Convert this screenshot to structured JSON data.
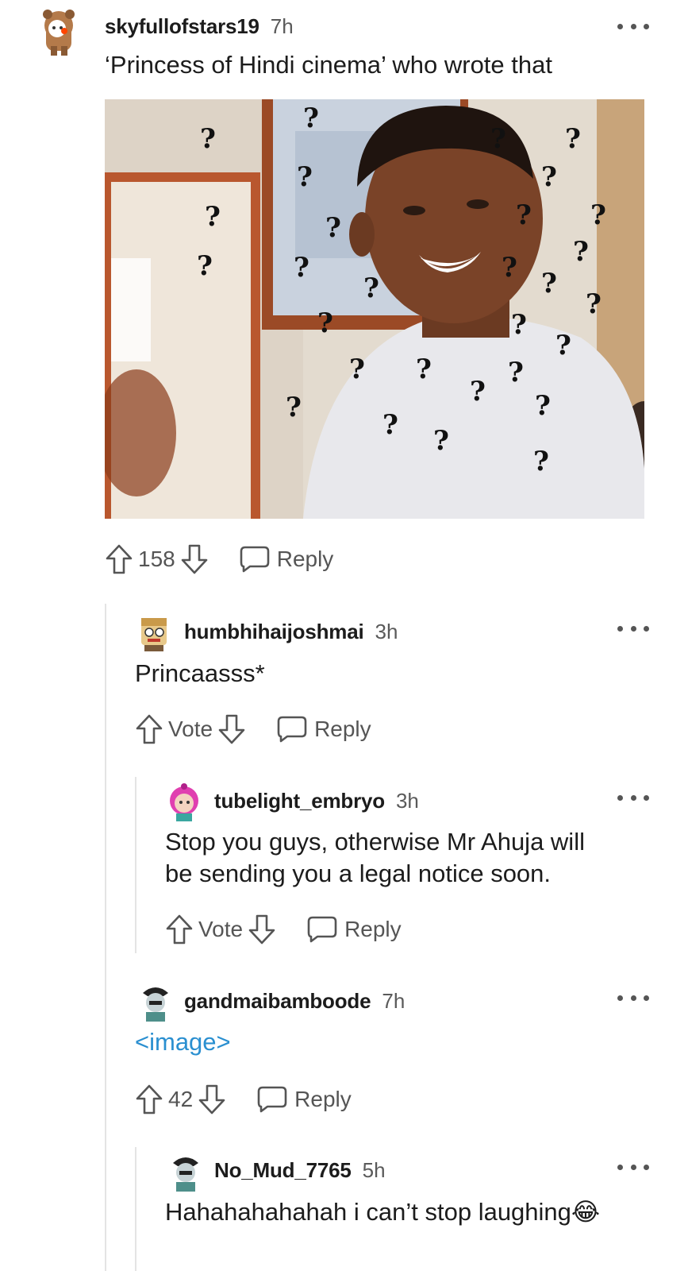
{
  "comments": [
    {
      "username": "skyfullofstars19",
      "time": "7h",
      "text": "‘Princess of Hindi cinema’ who wrote that",
      "votes": "158",
      "reply_label": "Reply"
    },
    {
      "username": "humbhihaijoshmai",
      "time": "3h",
      "text": "Princaasss*",
      "votes": "Vote",
      "reply_label": "Reply"
    },
    {
      "username": "tubelight_embryo",
      "time": "3h",
      "text_line1": "Stop you guys, otherwise Mr Ahuja will",
      "text_line2": "be sending you a legal notice soon.",
      "votes": "Vote",
      "reply_label": "Reply"
    },
    {
      "username": "gandmaibamboode",
      "time": "7h",
      "text": "<image>",
      "votes": "42",
      "reply_label": "Reply"
    },
    {
      "username": "No_Mud_7765",
      "time": "5h",
      "text": "Hahahahahahah i can’t stop laughing",
      "emoji": "😂"
    }
  ],
  "colors": {
    "link": "#2a8fd0",
    "meta_gray": "#5a5a5a",
    "thread_line": "#e4e4e4"
  },
  "icons": [
    "upvote-icon",
    "downvote-icon",
    "reply-bubble-icon",
    "more-dots-icon",
    "question-mark-meme-image"
  ]
}
